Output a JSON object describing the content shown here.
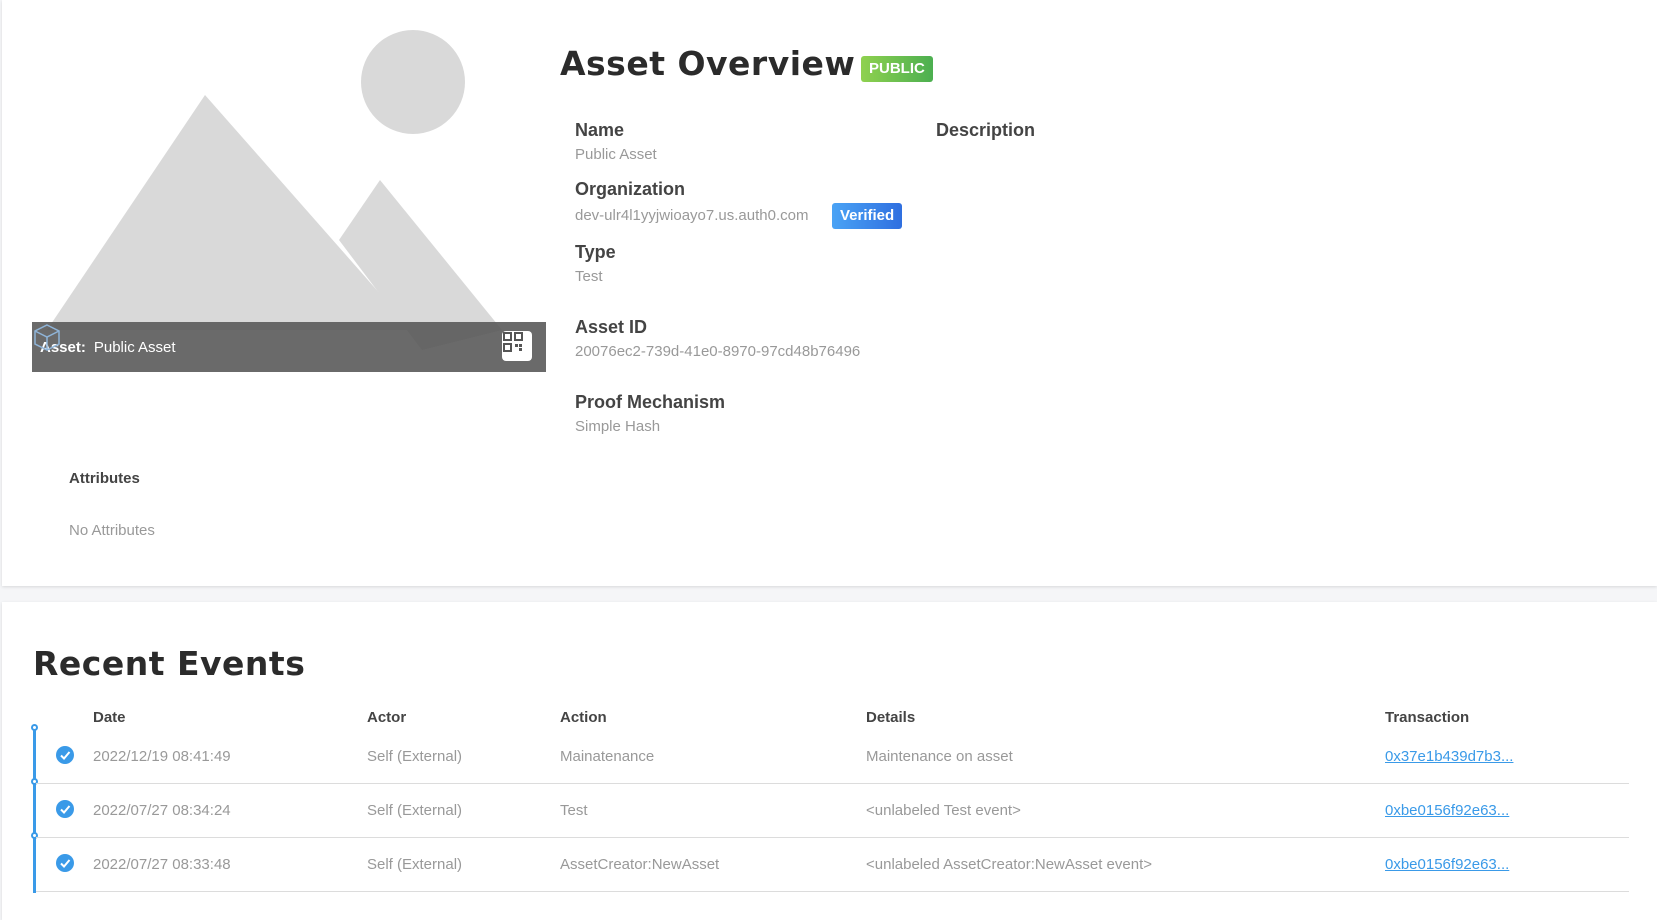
{
  "overview": {
    "title": "Asset Overview",
    "visibility_badge": "PUBLIC",
    "asset_bar": {
      "label": "Asset:",
      "name": "Public Asset"
    },
    "fields": {
      "name_label": "Name",
      "name_value": "Public Asset",
      "description_label": "Description",
      "organization_label": "Organization",
      "organization_value": "dev-ulr4l1yyjwioayo7.us.auth0.com",
      "verified_badge": "Verified",
      "type_label": "Type",
      "type_value": "Test",
      "asset_id_label": "Asset ID",
      "asset_id_value": "20076ec2-739d-41e0-8970-97cd48b76496",
      "proof_label": "Proof Mechanism",
      "proof_value": "Simple Hash"
    },
    "attributes": {
      "title": "Attributes",
      "empty_text": "No Attributes"
    }
  },
  "events": {
    "title": "Recent Events",
    "columns": [
      "Date",
      "Actor",
      "Action",
      "Details",
      "Transaction"
    ],
    "rows": [
      {
        "date": "2022/12/19 08:41:49",
        "actor": "Self (External)",
        "action": "Mainatenance",
        "details": "Maintenance on asset",
        "transaction": "0x37e1b439d7b3..."
      },
      {
        "date": "2022/07/27 08:34:24",
        "actor": "Self (External)",
        "action": "Test",
        "details": "<unlabeled Test event>",
        "transaction": "0xbe0156f92e63..."
      },
      {
        "date": "2022/07/27 08:33:48",
        "actor": "Self (External)",
        "action": "AssetCreator:NewAsset",
        "details": "<unlabeled AssetCreator:NewAsset event>",
        "transaction": "0xbe0156f92e63..."
      }
    ]
  },
  "colors": {
    "accent": "#3a9ae8",
    "public_badge": "#5cb946",
    "verified_badge": "#2f6fe0",
    "placeholder": "#d9d9d9"
  },
  "icons": [
    "cube-icon",
    "qr-code-icon",
    "check-circle-icon",
    "image-placeholder-icon"
  ]
}
